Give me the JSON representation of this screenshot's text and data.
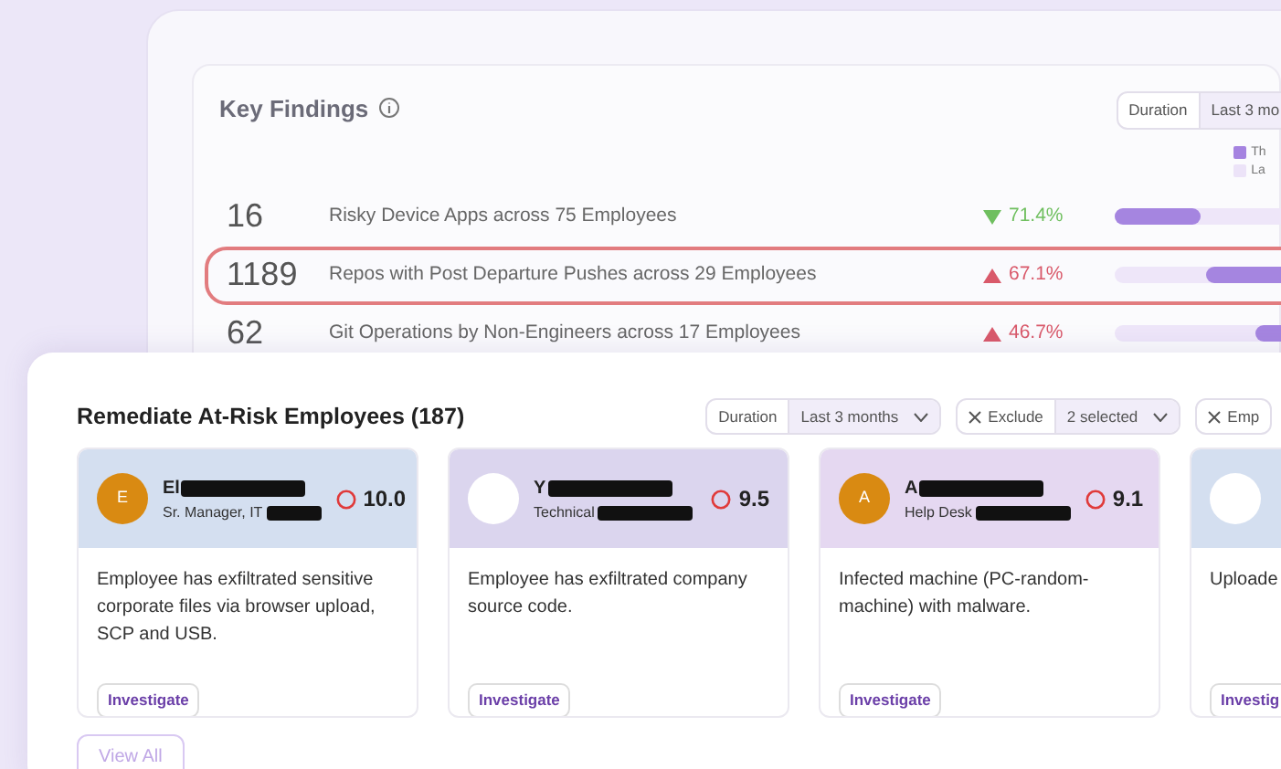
{
  "findings": {
    "title": "Key Findings",
    "duration": {
      "label": "Duration",
      "value": "Last 3 mo"
    },
    "legend": [
      {
        "label": "Th",
        "color": "#a583e0"
      },
      {
        "label": "La",
        "color": "#ece3f8"
      }
    ],
    "rows": [
      {
        "count": "16",
        "text": "Risky Device Apps across 75 Employees",
        "increase": false,
        "change": "71.4%",
        "level": 0.43,
        "dark_first": true,
        "highlighted": false
      },
      {
        "count": "1189",
        "text": "Repos with Post Departure Pushes across 29 Employees",
        "increase": true,
        "change": "67.1%",
        "level": 0.55,
        "dark_first": false,
        "highlighted": true
      },
      {
        "count": "62",
        "text": "Git Operations by Non-Engineers across 17 Employees",
        "increase": true,
        "change": "46.7%",
        "level": 0.3,
        "dark_first": false,
        "highlighted": false
      }
    ]
  },
  "remediate": {
    "title": "Remediate At-Risk Employees (187)",
    "filters": [
      {
        "kind": "pair",
        "label": "Duration",
        "value": "Last 3 months"
      },
      {
        "kind": "exclude",
        "label": "Exclude",
        "value": "2 selected"
      },
      {
        "kind": "exclude",
        "label": "Emp"
      }
    ],
    "cards": [
      {
        "name": "El",
        "role": "Sr. Manager, IT",
        "avatar": "E",
        "score": "10.0",
        "color": "#d4dff0",
        "description": "Employee has exfiltrated sensitive corporate files via browser upload, SCP and USB.",
        "action": "Investigate"
      },
      {
        "name": "Y",
        "role": "Technical",
        "score": "9.5",
        "color": "#dbd5ee",
        "description": "Employee has exfiltrated company source code.",
        "action": "Investigate"
      },
      {
        "name": "A",
        "role": "Help Desk",
        "avatar": "A",
        "score": "9.1",
        "color": "#e5d8f1",
        "description": "Infected machine (PC-random-machine) with malware.",
        "action": "Investigate"
      },
      {
        "color": "#d4dff0",
        "description": "Uploade",
        "action": "Investig"
      }
    ],
    "view_all": "View All"
  }
}
